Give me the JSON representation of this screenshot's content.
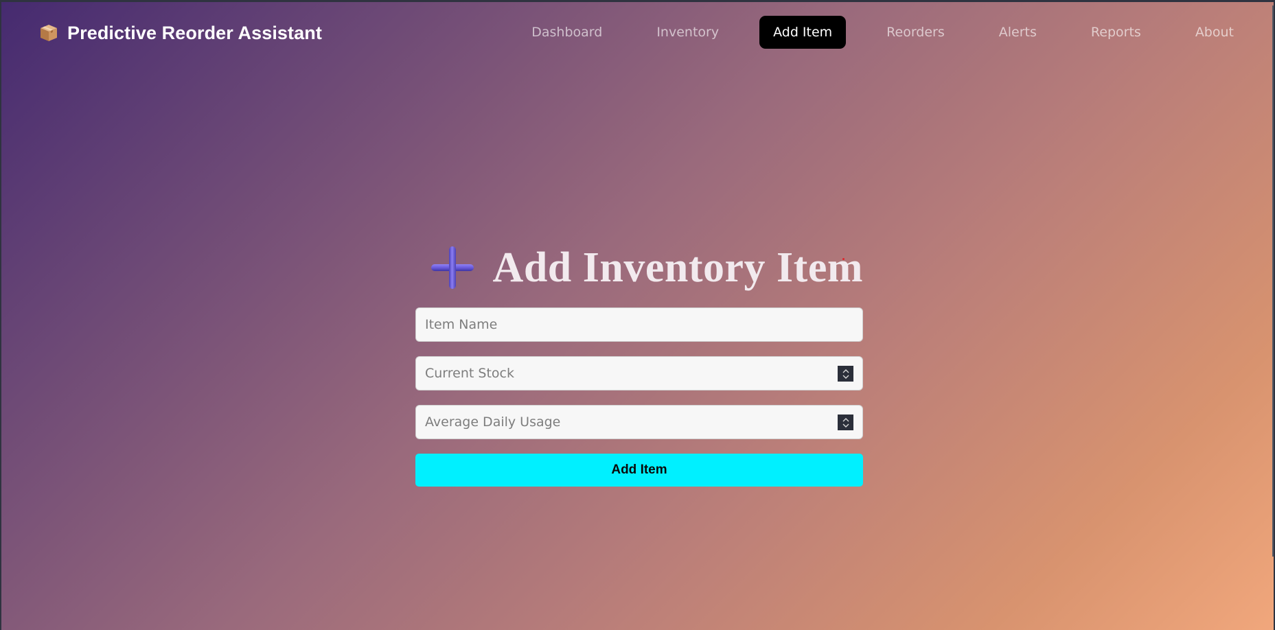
{
  "app": {
    "title": "Predictive Reorder Assistant",
    "logo_icon": "package-box-icon"
  },
  "nav": {
    "items": [
      {
        "label": "Dashboard",
        "active": false
      },
      {
        "label": "Inventory",
        "active": false
      },
      {
        "label": "Add Item",
        "active": true
      },
      {
        "label": "Reorders",
        "active": false
      },
      {
        "label": "Alerts",
        "active": false
      },
      {
        "label": "Reports",
        "active": false
      },
      {
        "label": "About",
        "active": false
      }
    ]
  },
  "page": {
    "heading_icon": "plus-icon",
    "heading": "Add Inventory Item"
  },
  "form": {
    "item_name": {
      "value": "",
      "placeholder": "Item Name"
    },
    "current_stock": {
      "value": "",
      "placeholder": "Current Stock"
    },
    "avg_daily_usage": {
      "value": "",
      "placeholder": "Average Daily Usage"
    },
    "submit_label": "Add Item"
  },
  "colors": {
    "accent_button": "#00f0ff",
    "active_nav_bg": "#000000",
    "gradient_start": "#452a70",
    "gradient_end": "#f1a77c"
  }
}
